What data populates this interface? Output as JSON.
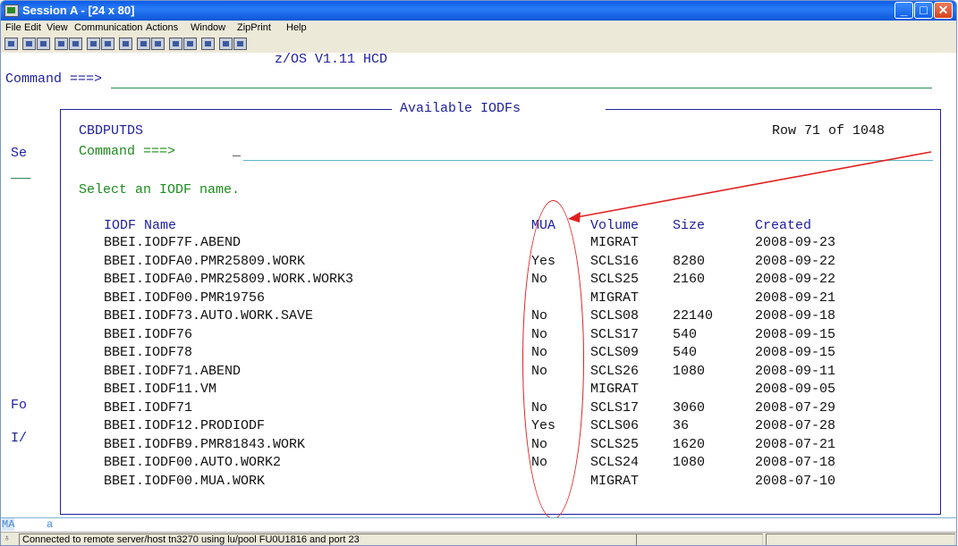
{
  "window": {
    "title": "Session A - [24 x 80]"
  },
  "menu": [
    "File",
    "Edit",
    "View",
    "Communication",
    "Actions",
    "Window",
    "ZipPrint",
    "Help"
  ],
  "screen": {
    "header": "z/OS V1.11 HCD",
    "outer_command_label": "Command ===>",
    "left_labels": {
      "se": "Se",
      "fo": "Fo",
      "io": "I/"
    },
    "popup": {
      "title": "Available IODFs",
      "panel_id": "CBDPUTDS",
      "row_info": "Row 71 of 1048",
      "command_label": "Command ===>",
      "cursor": "_",
      "instruction": "Select an IODF name.",
      "columns": {
        "name": "IODF Name",
        "mua": "MUA",
        "volume": "Volume",
        "size": "Size",
        "created": "Created"
      },
      "rows": [
        {
          "name": "BBEI.IODF7F.ABEND",
          "mua": "",
          "volume": "MIGRAT",
          "size": "",
          "created": "2008-09-23"
        },
        {
          "name": "BBEI.IODFA0.PMR25809.WORK",
          "mua": "Yes",
          "volume": "SCLS16",
          "size": "8280",
          "created": "2008-09-22"
        },
        {
          "name": "BBEI.IODFA0.PMR25809.WORK.WORK3",
          "mua": "No",
          "volume": "SCLS25",
          "size": "2160",
          "created": "2008-09-22"
        },
        {
          "name": "BBEI.IODF00.PMR19756",
          "mua": "",
          "volume": "MIGRAT",
          "size": "",
          "created": "2008-09-21"
        },
        {
          "name": "BBEI.IODF73.AUTO.WORK.SAVE",
          "mua": "No",
          "volume": "SCLS08",
          "size": "22140",
          "created": "2008-09-18"
        },
        {
          "name": "BBEI.IODF76",
          "mua": "No",
          "volume": "SCLS17",
          "size": "540",
          "created": "2008-09-15"
        },
        {
          "name": "BBEI.IODF78",
          "mua": "No",
          "volume": "SCLS09",
          "size": "540",
          "created": "2008-09-15"
        },
        {
          "name": "BBEI.IODF71.ABEND",
          "mua": "No",
          "volume": "SCLS26",
          "size": "1080",
          "created": "2008-09-11"
        },
        {
          "name": "BBEI.IODF11.VM",
          "mua": "",
          "volume": "MIGRAT",
          "size": "",
          "created": "2008-09-05"
        },
        {
          "name": "BBEI.IODF71",
          "mua": "No",
          "volume": "SCLS17",
          "size": "3060",
          "created": "2008-07-29"
        },
        {
          "name": "BBEI.IODF12.PRODIODF",
          "mua": "Yes",
          "volume": "SCLS06",
          "size": "36",
          "created": "2008-07-28"
        },
        {
          "name": "BBEI.IODFB9.PMR81843.WORK",
          "mua": "No",
          "volume": "SCLS25",
          "size": "1620",
          "created": "2008-07-21"
        },
        {
          "name": "BBEI.IODF00.AUTO.WORK2",
          "mua": "No",
          "volume": "SCLS24",
          "size": "1080",
          "created": "2008-07-18"
        },
        {
          "name": "BBEI.IODF00.MUA.WORK",
          "mua": "",
          "volume": "MIGRAT",
          "size": "",
          "created": "2008-07-10"
        }
      ]
    },
    "oia": {
      "indicator": "MA",
      "text": "a"
    }
  },
  "statusbar": {
    "message": "Connected to remote server/host tn3270 using lu/pool FU0U1816 and port 23"
  },
  "colors": {
    "title_bar": "#0a5ce8",
    "terminal_blue": "#1e1e9e",
    "terminal_green": "#1e8a1e",
    "annotation_red": "#e02020"
  },
  "icons": [
    "app-icon",
    "minimize-icon",
    "maximize-icon",
    "close-icon"
  ]
}
